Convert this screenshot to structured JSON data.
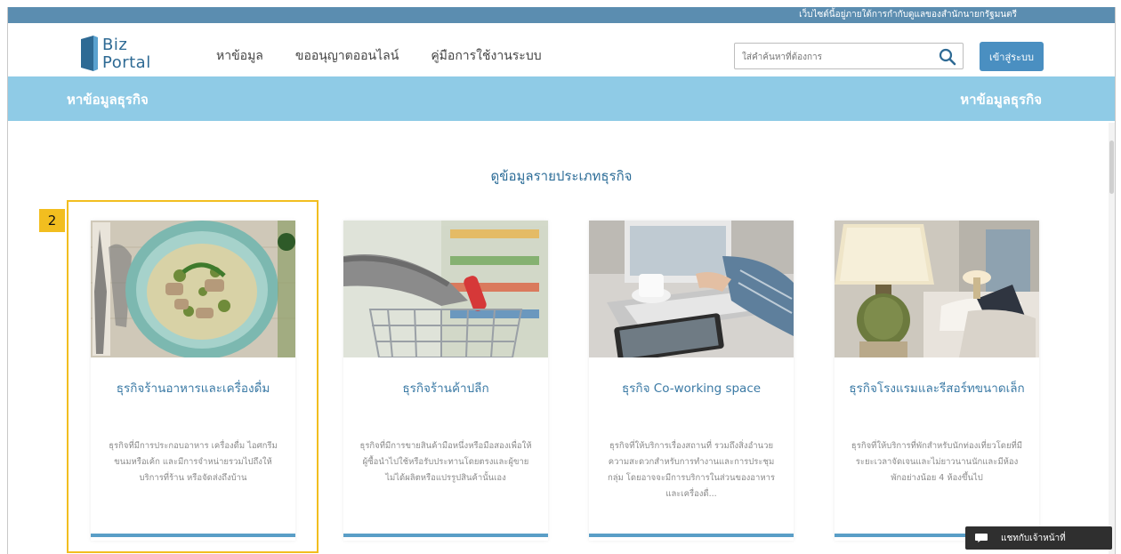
{
  "top_banner": {
    "text": "เว็บไซต์นี้อยู่ภายใต้การกำกับดูแลของสำนักนายกรัฐมนตรี"
  },
  "logo": {
    "line1": "Biz",
    "line2": "Portal"
  },
  "nav": {
    "items": [
      {
        "label": "หาข้อมูล"
      },
      {
        "label": "ขออนุญาตออนไลน์"
      },
      {
        "label": "คู่มือการใช้งานระบบ"
      }
    ]
  },
  "search": {
    "placeholder": "ใส่คำค้นหาที่ต้องการ",
    "icon": "search-icon"
  },
  "login": {
    "label": "เข้าสู่ระบบ"
  },
  "section": {
    "title_left": "หาข้อมูลธุรกิจ",
    "title_right": "หาข้อมูลธุรกิจ"
  },
  "heading": "ดูข้อมูลรายประเภทธุรกิจ",
  "badge": "2",
  "cards": [
    {
      "title": "ธุรกิจร้านอาหารและเครื่องดื่ม",
      "desc": "ธุรกิจที่มีการประกอบอาหาร เครื่องดื่ม ไอศกรีม ขนมหรือเค้ก และมีการจำหน่ายรวมไปถึงให้บริการที่ร้าน หรือจัดส่งถึงบ้าน",
      "image": "green-curry-bowl"
    },
    {
      "title": "ธุรกิจร้านค้าปลีก",
      "desc": "ธุรกิจที่มีการขายสินค้ามือหนึ่งหรือมือสองเพื่อให้ผู้ซื้อนำไปใช้หรือรับประทานโดยตรงและผู้ขายไม่ได้ผลิตหรือแปรรูปสินค้านั้นเอง",
      "image": "shopping-cart"
    },
    {
      "title": "ธุรกิจ Co-working space",
      "desc": "ธุรกิจที่ให้บริการเรื่องสถานที่ รวมถึงสิ่งอำนวยความสะดวกสำหรับการทำงานและการประชุมกลุ่ม โดยอาจจะมีการบริการในส่วนของอาหาร และเครื่องดื่...",
      "image": "laptop-coffee"
    },
    {
      "title": "ธุรกิจโรงแรมและรีสอร์ทขนาดเล็ก",
      "desc": "ธุรกิจที่ให้บริการที่พักสำหรับนักท่องเที่ยวโดยที่มีระยะเวลาจัดเจนและไม่ยาวนานนักและมีห้องพักอย่างน้อย 4 ห้องขึ้นไป",
      "image": "hotel-lamp"
    }
  ],
  "chat": {
    "label": "แชทกับเจ้าหน้าที่",
    "icon": "chat-bubble-icon"
  },
  "colors": {
    "accent": "#4a8fc1",
    "section_bar": "#8fcbe6",
    "highlight": "#f2be1f",
    "title": "#3b7aa5"
  }
}
